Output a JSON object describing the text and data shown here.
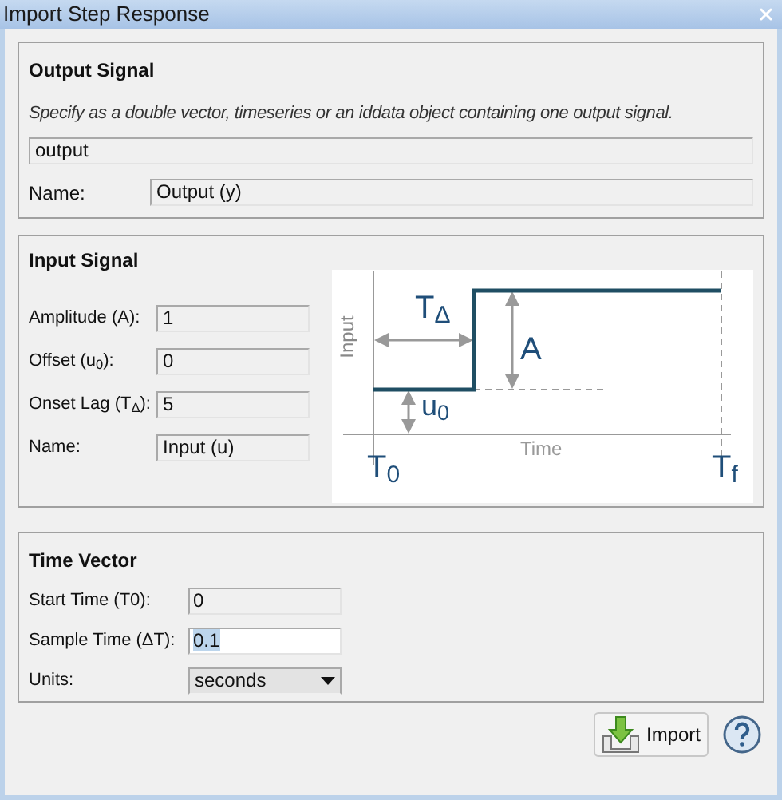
{
  "window": {
    "title": "Import Step Response"
  },
  "output_signal": {
    "title": "Output Signal",
    "description": "Specify as a double vector, timeseries or an iddata object containing one output signal.",
    "value": "output",
    "name_label": "Name:",
    "name_value": "Output (y)"
  },
  "input_signal": {
    "title": "Input Signal",
    "fields": [
      {
        "label": "Amplitude (A):",
        "value": "1"
      },
      {
        "label": "Offset (u$_{0}$):",
        "value": "0"
      },
      {
        "label": "Onset Lag (T$_{Δ}$):",
        "value": "5"
      },
      {
        "label": "Name:",
        "value": "Input (u)"
      }
    ],
    "diagram": {
      "labels": [
        {
          "kind": "ylabel",
          "text": "Input"
        },
        {
          "kind": "lag",
          "text": "T$_{Δ}$"
        },
        {
          "kind": "amplitude",
          "text": "A"
        },
        {
          "kind": "offset",
          "text": "u$_{0}$"
        },
        {
          "kind": "xlabel",
          "text": "Time"
        },
        {
          "kind": "start",
          "text": "T$_{0}$"
        },
        {
          "kind": "end",
          "text": "T$_{f}$"
        }
      ]
    }
  },
  "time_vector": {
    "title": "Time Vector",
    "fields": [
      {
        "kind": "text",
        "label": "Start Time (T0):",
        "value": "0",
        "focused": false
      },
      {
        "kind": "text",
        "label": "Sample Time (ΔT):",
        "value": "0.1",
        "focused": true
      },
      {
        "kind": "select",
        "label": "Units:",
        "value": "seconds"
      }
    ]
  },
  "buttons": [
    {
      "kind": "import",
      "label": "Import"
    },
    {
      "kind": "help"
    }
  ]
}
